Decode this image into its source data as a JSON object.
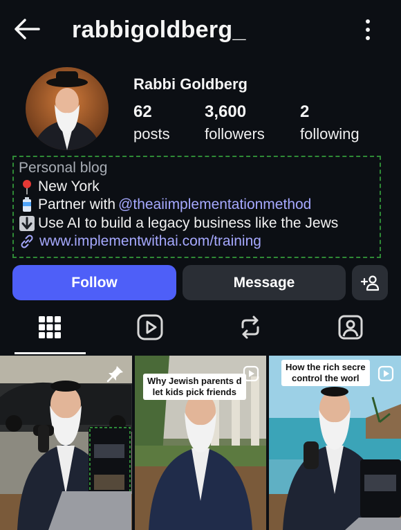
{
  "header": {
    "username": "rabbigoldberg_",
    "back_icon": "arrow-left-icon",
    "menu_icon": "more-vertical-icon"
  },
  "profile": {
    "display_name": "Rabbi Goldberg",
    "stats": {
      "posts": {
        "count": "62",
        "label": "posts"
      },
      "followers": {
        "count": "3,600",
        "label": "followers"
      },
      "following": {
        "count": "2",
        "label": "following"
      }
    },
    "bio": {
      "category": "Personal blog",
      "location": "New York",
      "partner_prefix": "Partner with",
      "partner_handle": "@theaiimplementationmethod",
      "tagline": "Use AI to build a legacy business like the Jews",
      "link": "www.implementwithai.com/training"
    }
  },
  "actions": {
    "follow_label": "Follow",
    "message_label": "Message",
    "add_user_icon": "person-add-icon"
  },
  "tabs": [
    {
      "name": "posts-grid",
      "icon": "grid-icon"
    },
    {
      "name": "reels",
      "icon": "reels-play-icon"
    },
    {
      "name": "reposts",
      "icon": "repost-icon"
    },
    {
      "name": "tagged",
      "icon": "tagged-person-icon"
    }
  ],
  "posts": [
    {
      "caption": "",
      "badge": "pin-icon"
    },
    {
      "caption": "Why Jewish parents d\nlet kids pick friends",
      "badge": "reel-icon"
    },
    {
      "caption": "How the rich secre\ncontrol the worl",
      "badge": "reel-icon"
    }
  ],
  "colors": {
    "background": "#0c0f14",
    "follow_button": "#4e5ff8",
    "secondary_button": "#2a2e35",
    "link": "#a6a9ff"
  }
}
